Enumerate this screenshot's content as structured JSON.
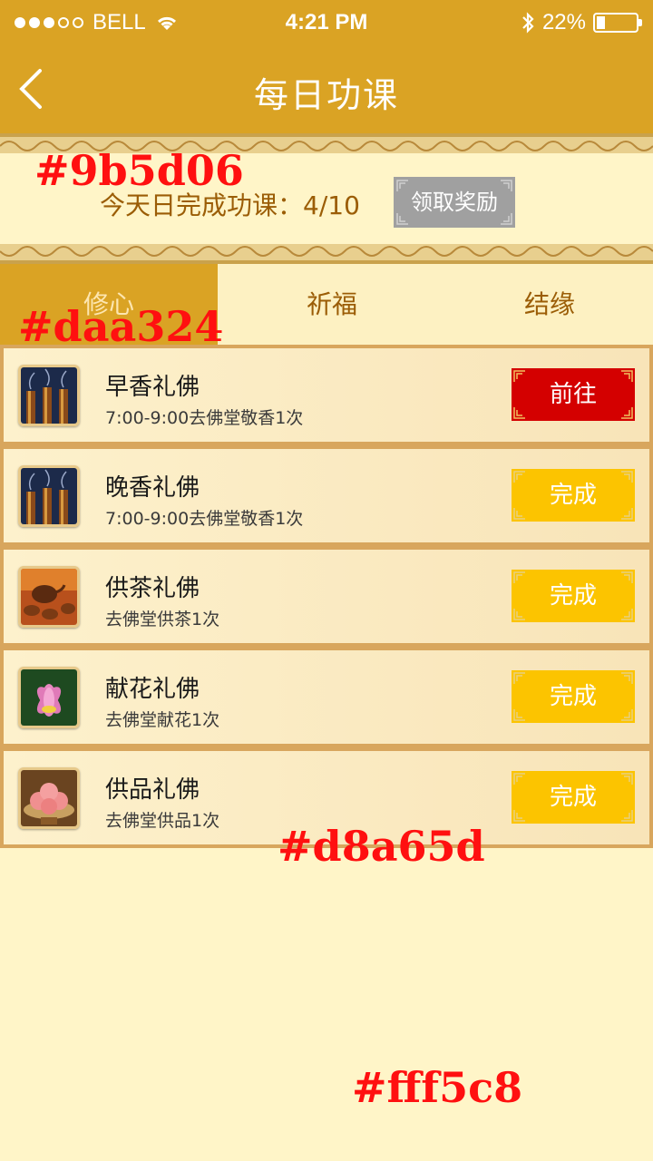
{
  "status_bar": {
    "carrier": "BELL",
    "time": "4:21 PM",
    "battery_percent": "22%",
    "battery_level": 0.22,
    "signal_strength": 3
  },
  "nav": {
    "title": "每日功课",
    "back_icon": "chevron-left-icon"
  },
  "summary": {
    "progress_text": "今天日完成功课：4/10",
    "reward_button": "领取奖励"
  },
  "tabs": [
    {
      "label": "修心",
      "active": true
    },
    {
      "label": "祈福",
      "active": false
    },
    {
      "label": "结缘",
      "active": false
    }
  ],
  "tasks": [
    {
      "name": "早香礼佛",
      "desc": "7:00-9:00去佛堂敬香1次",
      "action": "前往",
      "state": "go",
      "thumb": "incense"
    },
    {
      "name": "晚香礼佛",
      "desc": "7:00-9:00去佛堂敬香1次",
      "action": "完成",
      "state": "done",
      "thumb": "incense"
    },
    {
      "name": "供茶礼佛",
      "desc": "去佛堂供茶1次",
      "action": "完成",
      "state": "done",
      "thumb": "tea"
    },
    {
      "name": "献花礼佛",
      "desc": "去佛堂献花1次",
      "action": "完成",
      "state": "done",
      "thumb": "lotus"
    },
    {
      "name": "供品礼佛",
      "desc": "去佛堂供品1次",
      "action": "完成",
      "state": "done",
      "thumb": "peach"
    }
  ],
  "annotations": {
    "a1": "#9b5d06",
    "a2": "#daa324",
    "a3": "#d8a65d",
    "a4": "#fff5c8"
  },
  "colors": {
    "header": "#daa324",
    "brown_text": "#9b5d06",
    "row_border": "#d8a65d",
    "background": "#fff5c8",
    "go_button": "#d40000",
    "done_button": "#fcc400"
  }
}
